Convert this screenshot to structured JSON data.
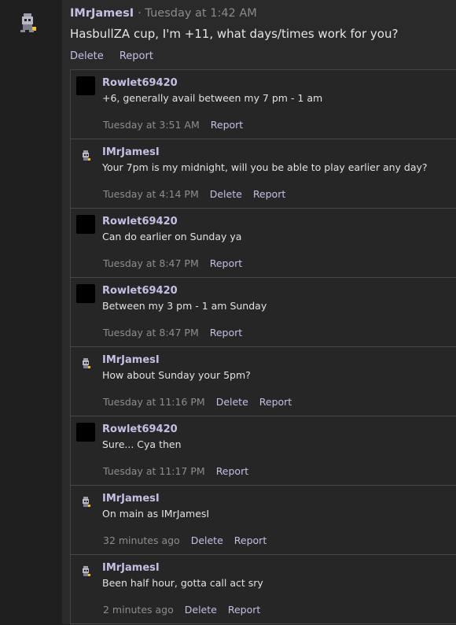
{
  "post": {
    "author": "IMrJamesI",
    "time": "· Tuesday at 1:42 AM",
    "text": "HasbullZA cup, I'm +11, what days/times work for you?",
    "delete_label": "Delete",
    "report_label": "Report"
  },
  "comments": [
    {
      "author": "Rowlet69420",
      "text": "+6, generally avail between my 7 pm - 1 am",
      "time": "Tuesday at 3:51 AM",
      "actions": [
        "Report"
      ],
      "avatar": "black"
    },
    {
      "author": "IMrJamesI",
      "text": "Your 7pm is my midnight, will you be able to play earlier any day?",
      "time": "Tuesday at 4:14 PM",
      "actions": [
        "Delete",
        "Report"
      ],
      "avatar": "sprite"
    },
    {
      "author": "Rowlet69420",
      "text": "Can do earlier on Sunday ya",
      "time": "Tuesday at 8:47 PM",
      "actions": [
        "Report"
      ],
      "avatar": "black"
    },
    {
      "author": "Rowlet69420",
      "text": "Between my 3 pm - 1 am Sunday",
      "time": "Tuesday at 8:47 PM",
      "actions": [
        "Report"
      ],
      "avatar": "black"
    },
    {
      "author": "IMrJamesI",
      "text": "How about Sunday your 5pm?",
      "time": "Tuesday at 11:16 PM",
      "actions": [
        "Delete",
        "Report"
      ],
      "avatar": "sprite"
    },
    {
      "author": "Rowlet69420",
      "text": "Sure... Cya then",
      "time": "Tuesday at 11:17 PM",
      "actions": [
        "Report"
      ],
      "avatar": "black"
    },
    {
      "author": "IMrJamesI",
      "text": "On main as IMrJamesI",
      "time": "32 minutes ago",
      "actions": [
        "Delete",
        "Report"
      ],
      "avatar": "sprite"
    },
    {
      "author": "IMrJamesI",
      "text": "Been half hour, gotta call act sry",
      "time": "2 minutes ago",
      "actions": [
        "Delete",
        "Report"
      ],
      "avatar": "sprite"
    }
  ]
}
